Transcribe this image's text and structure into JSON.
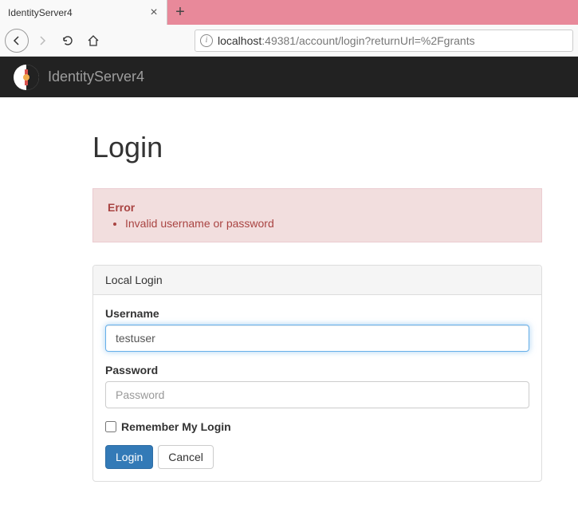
{
  "browser": {
    "tab_title": "IdentityServer4",
    "url_host": "localhost",
    "url_path": ":49381/account/login?returnUrl=%2Fgrants"
  },
  "navbar": {
    "brand": "IdentityServer4"
  },
  "page": {
    "title": "Login"
  },
  "alert": {
    "heading": "Error",
    "message": "Invalid username or password"
  },
  "panel": {
    "heading": "Local Login"
  },
  "form": {
    "username_label": "Username",
    "username_value": "testuser",
    "password_label": "Password",
    "password_placeholder": "Password",
    "remember_label": "Remember My Login",
    "login_button": "Login",
    "cancel_button": "Cancel"
  }
}
